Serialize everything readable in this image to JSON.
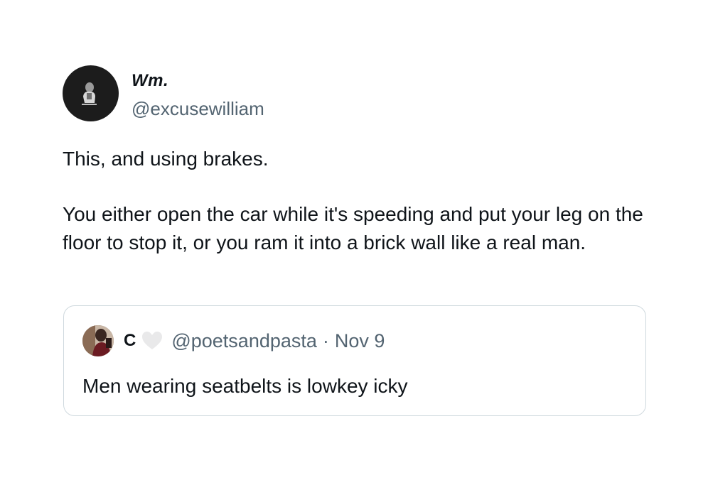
{
  "tweet": {
    "author": {
      "display_name": "Wm.",
      "handle": "@excusewilliam",
      "avatar_icon": "user-avatar-icon"
    },
    "text_paragraph_1": "This, and using brakes.",
    "text_paragraph_2": "You either open the car while it's speeding and put your leg on the floor to stop it, or you ram it into a brick wall like a real man."
  },
  "quoted_tweet": {
    "author": {
      "display_name": "C",
      "badge_icon": "white-heart-icon",
      "handle": "@poetsandpasta",
      "separator": "·",
      "date": "Nov 9"
    },
    "text": "Men wearing seatbelts is lowkey icky"
  },
  "colors": {
    "text_primary": "#0f1419",
    "text_secondary": "#536471",
    "border": "#cfd9de",
    "avatar_bg": "#1c1c1c"
  }
}
